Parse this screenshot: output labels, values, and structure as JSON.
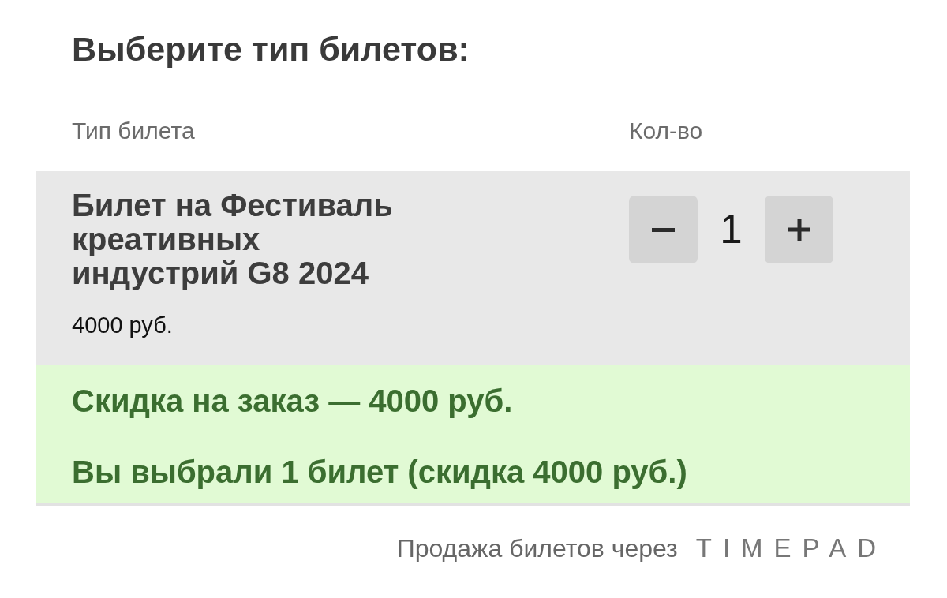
{
  "title": "Выберите тип билетов:",
  "table": {
    "columns": [
      "Тип билета",
      "Кол-во"
    ],
    "rows": [
      {
        "name": "Билет на Фестиваль креативных индустрий G8 2024",
        "price": "4000 руб.",
        "quantity": "1"
      }
    ]
  },
  "discount": {
    "messages": [
      "Скидка на заказ — 4000 руб.",
      "Вы выбрали 1 билет (скидка 4000 руб.)"
    ]
  },
  "footer": {
    "text": "Продажа билетов через",
    "logo": "TIMEPAD"
  }
}
